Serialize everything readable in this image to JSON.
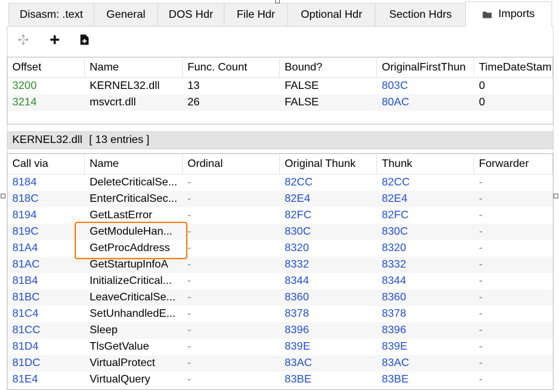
{
  "tabs": [
    {
      "label": "Disasm: .text",
      "active": false
    },
    {
      "label": "General",
      "active": false
    },
    {
      "label": "DOS Hdr",
      "active": false
    },
    {
      "label": "File Hdr",
      "active": false
    },
    {
      "label": "Optional Hdr",
      "active": false
    },
    {
      "label": "Section Hdrs",
      "active": false
    },
    {
      "label": "Imports",
      "active": true,
      "icon": "folder-icon"
    }
  ],
  "toolbar": [
    {
      "icon": "move-icon"
    },
    {
      "icon": "plus-icon"
    },
    {
      "icon": "add-file-icon"
    }
  ],
  "libraries_table": {
    "columns": [
      "Offset",
      "Name",
      "Func. Count",
      "Bound?",
      "OriginalFirstThun",
      "TimeDateStamp"
    ],
    "rows": [
      {
        "offset": "3200",
        "name": "KERNEL32.dll",
        "func_count": "13",
        "bound": "FALSE",
        "original_first_thunk": "803C",
        "time_date_stamp": "0"
      },
      {
        "offset": "3214",
        "name": "msvcrt.dll",
        "func_count": "26",
        "bound": "FALSE",
        "original_first_thunk": "80AC",
        "time_date_stamp": "0"
      }
    ]
  },
  "entries_bar": {
    "library": "KERNEL32.dll",
    "count": "[ 13 entries ]"
  },
  "functions_table": {
    "columns": [
      "Call via",
      "Name",
      "Ordinal",
      "Original Thunk",
      "Thunk",
      "Forwarder"
    ],
    "rows": [
      {
        "call_via": "8184",
        "name": "DeleteCriticalSe...",
        "ordinal": "-",
        "original_thunk": "82CC",
        "thunk": "82CC",
        "forwarder": "-"
      },
      {
        "call_via": "818C",
        "name": "EnterCriticalSec...",
        "ordinal": "-",
        "original_thunk": "82E4",
        "thunk": "82E4",
        "forwarder": "-"
      },
      {
        "call_via": "8194",
        "name": "GetLastError",
        "ordinal": "-",
        "original_thunk": "82FC",
        "thunk": "82FC",
        "forwarder": "-"
      },
      {
        "call_via": "819C",
        "name": "GetModuleHan...",
        "ordinal": "-",
        "original_thunk": "830C",
        "thunk": "830C",
        "forwarder": "-"
      },
      {
        "call_via": "81A4",
        "name": "GetProcAddress",
        "ordinal": "-",
        "original_thunk": "8320",
        "thunk": "8320",
        "forwarder": "-"
      },
      {
        "call_via": "81AC",
        "name": "GetStartupInfoA",
        "ordinal": "-",
        "original_thunk": "8332",
        "thunk": "8332",
        "forwarder": "-"
      },
      {
        "call_via": "81B4",
        "name": "InitializeCritical...",
        "ordinal": "-",
        "original_thunk": "8344",
        "thunk": "8344",
        "forwarder": "-"
      },
      {
        "call_via": "81BC",
        "name": "LeaveCriticalSe...",
        "ordinal": "-",
        "original_thunk": "8360",
        "thunk": "8360",
        "forwarder": "-"
      },
      {
        "call_via": "81C4",
        "name": "SetUnhandledE...",
        "ordinal": "-",
        "original_thunk": "8378",
        "thunk": "8378",
        "forwarder": "-"
      },
      {
        "call_via": "81CC",
        "name": "Sleep",
        "ordinal": "-",
        "original_thunk": "8396",
        "thunk": "8396",
        "forwarder": "-"
      },
      {
        "call_via": "81D4",
        "name": "TlsGetValue",
        "ordinal": "-",
        "original_thunk": "839E",
        "thunk": "839E",
        "forwarder": "-"
      },
      {
        "call_via": "81DC",
        "name": "VirtualProtect",
        "ordinal": "-",
        "original_thunk": "83AC",
        "thunk": "83AC",
        "forwarder": "-"
      },
      {
        "call_via": "81E4",
        "name": "VirtualQuery",
        "ordinal": "-",
        "original_thunk": "83BE",
        "thunk": "83BE",
        "forwarder": "-"
      }
    ]
  },
  "highlight": {
    "first_row": 3,
    "last_row": 4
  },
  "colors": {
    "offset": "#2c8c2c",
    "address": "#1f4fd0",
    "dash": "#808080",
    "highlight": "#f0841f",
    "alt_row": "#f6f6f6",
    "bar": "#e3e3e3"
  }
}
